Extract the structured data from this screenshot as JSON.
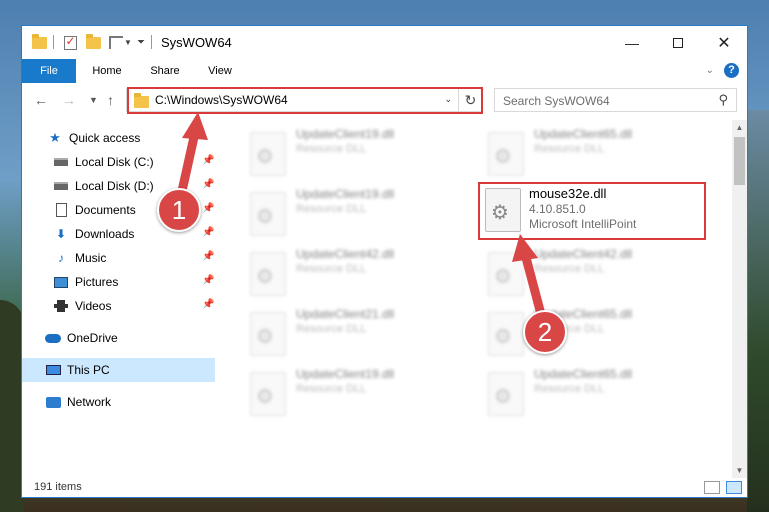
{
  "window": {
    "title": "SysWOW64"
  },
  "ribbon": {
    "tabs": [
      "File",
      "Home",
      "Share",
      "View"
    ],
    "help": "?"
  },
  "address": {
    "path": "C:\\Windows\\SysWOW64",
    "search_placeholder": "Search SysWOW64"
  },
  "sidebar": {
    "items": [
      {
        "label": "Quick access",
        "icon": "star-icon"
      },
      {
        "label": "Local Disk (C:)",
        "icon": "drive-icon",
        "pinned": true
      },
      {
        "label": "Local Disk (D:)",
        "icon": "drive-icon",
        "pinned": true
      },
      {
        "label": "Documents",
        "icon": "document-icon",
        "pinned": true
      },
      {
        "label": "Downloads",
        "icon": "download-icon",
        "pinned": true
      },
      {
        "label": "Music",
        "icon": "music-icon",
        "pinned": true
      },
      {
        "label": "Pictures",
        "icon": "pictures-icon",
        "pinned": true
      },
      {
        "label": "Videos",
        "icon": "video-icon",
        "pinned": true
      },
      {
        "label": "OneDrive",
        "icon": "cloud-icon"
      },
      {
        "label": "This PC",
        "icon": "computer-icon",
        "selected": true
      },
      {
        "label": "Network",
        "icon": "network-icon"
      }
    ]
  },
  "files": [
    {
      "name": "UpdateClient19.dll",
      "type": "Resource DLL"
    },
    {
      "name": "UpdateClient65.dll",
      "type": "Resource DLL"
    },
    {
      "name": "UpdateClient19.dll",
      "type": "Resource DLL"
    },
    {
      "name": "UpdateClient42.dll",
      "type": "Resource DLL"
    },
    {
      "name": "UpdateClient42.dll",
      "type": "Resource DLL"
    },
    {
      "name": "UpdateClient21.dll",
      "type": "Resource DLL"
    },
    {
      "name": "UpdateClient65.dll",
      "type": "Resource DLL"
    },
    {
      "name": "UpdateClient19.dll",
      "type": "Resource DLL"
    },
    {
      "name": "UpdateClient65.dll",
      "type": "Resource DLL"
    }
  ],
  "highlighted_file": {
    "name": "mouse32e.dll",
    "version": "4.10.851.0",
    "description": "Microsoft IntelliPoint"
  },
  "status": {
    "item_count": "191 items"
  },
  "callouts": {
    "step1": "1",
    "step2": "2"
  },
  "colors": {
    "accent": "#1979ca",
    "highlight": "#d83a3a",
    "selected": "#cce8ff"
  }
}
